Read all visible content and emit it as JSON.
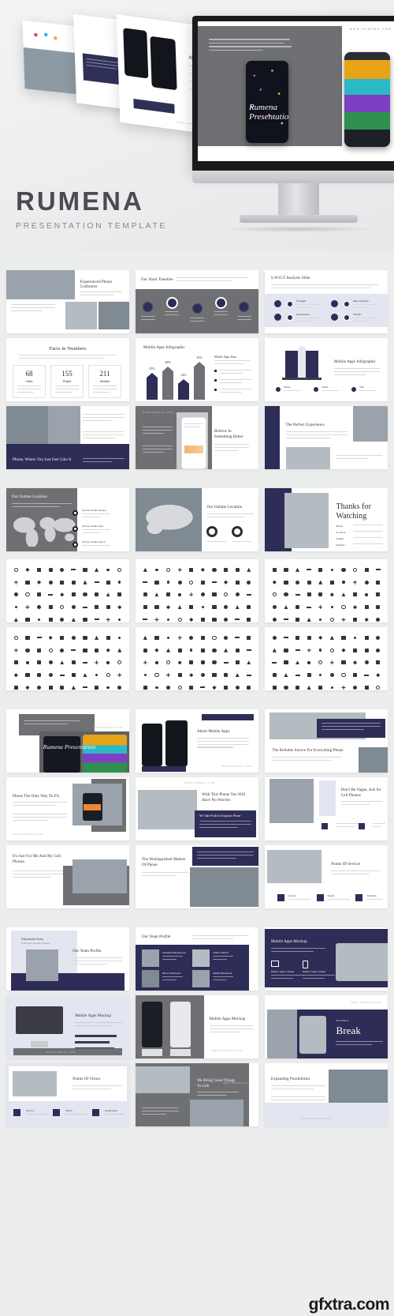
{
  "hero": {
    "brand_name": "RUMENA",
    "brand_subtitle": "PRESENTATION TEMPLATE",
    "mockup_watermark": "WWW.RUMENA.COM",
    "screen_slide_title_line1": "Rumena",
    "screen_slide_title_line2": "Presentation",
    "floating_slide_titles": [
      "With This Phone You Will Have No Worries",
      "About Mobile Apps"
    ],
    "floating_slide_small_label": "We Take Pride In Exquisite Phone"
  },
  "colors": {
    "navy": "#2d2d57",
    "gray": "#6f7073",
    "lavender": "#e3e5f1",
    "page_background": "#eceded",
    "slide_background": "#ffffff",
    "text_dark": "#2e2e35"
  },
  "watermark": "gfxtra.com",
  "sections": [
    {
      "name": "infographic-slides",
      "rows": [
        [
          {
            "title": "Experienced Phone Craftsmen",
            "layout": "image-left-text-right"
          },
          {
            "title": "Our Short Timeline",
            "layout": "timeline-gray",
            "steps": [
              "Brief",
              "Idea",
              "Design",
              "Test",
              "Applicate"
            ]
          },
          {
            "title": "S.W.O.T Analysis Slide",
            "layout": "swot-lavender",
            "items": [
              "Strength",
              "Weaknesses",
              "Opportunities",
              "Threats"
            ]
          }
        ],
        [
          {
            "title": "Facts in Numbers",
            "layout": "stat-boxes",
            "stats": [
              {
                "value": "68",
                "label": "Client"
              },
              {
                "value": "155",
                "label": "Project"
              },
              {
                "value": "211",
                "label": "Website"
              }
            ]
          },
          {
            "title": "Mobile Apps Infographic",
            "layout": "arrow-bars",
            "bars": [
              "25%",
              "28%",
              "14%",
              "35%"
            ]
          },
          {
            "title": "Mobile Apps Infographic",
            "layout": "rocket-illustration",
            "items": [
              "Phone",
              "Tablet",
              "Web"
            ]
          }
        ],
        [
          {
            "title": "Phone, Where You Just Feel Like It",
            "layout": "navy-band-images"
          },
          {
            "title": "Believe In Something Better",
            "layout": "gray-phone-mockup"
          },
          {
            "title": "The Perfect Experience",
            "layout": "navy-sidebar-images"
          }
        ]
      ]
    },
    {
      "name": "map-slides",
      "rows": [
        [
          {
            "title": "Our Outlate Location",
            "layout": "world-map-gray",
            "points": [
              "Service Point Europe",
              "Service Point Asia",
              "Service Point Africa"
            ]
          },
          {
            "title": "Our Outlate Location",
            "layout": "usa-map-photo",
            "charts": [
              "donut",
              "donut"
            ]
          },
          {
            "title": "Thanks for Watching",
            "layout": "navy-sidebar-phone",
            "contacts": [
              "Phone",
              "Location",
              "E-Mail",
              "Website"
            ]
          }
        ]
      ]
    },
    {
      "name": "icon-sheets",
      "rows": [
        [
          {
            "layout": "icon-grid"
          },
          {
            "layout": "icon-grid"
          },
          {
            "layout": "icon-grid"
          }
        ],
        [
          {
            "layout": "icon-grid"
          },
          {
            "layout": "icon-grid"
          },
          {
            "layout": "icon-grid"
          }
        ]
      ]
    },
    {
      "name": "content-slides",
      "rows": [
        [
          {
            "title": "Rumena Presentation",
            "layout": "cover-gray-phone"
          },
          {
            "title": "About Mobile Apps",
            "layout": "two-phones-text"
          },
          {
            "title": "The Reliable Source For Everything Phone",
            "layout": "desk-photo-navy-box"
          }
        ],
        [
          {
            "title": "Phone The Only Way To Fly",
            "layout": "text-left-photo-right"
          },
          {
            "title": "With This Phone You Will Have No Worries",
            "layout": "photo-navy-caption",
            "caption": "We Take Pride In Exquisite Phone"
          },
          {
            "title": "Don't Be Vague, Ask for Cell Phones",
            "layout": "portrait-photo-text"
          }
        ],
        [
          {
            "title": "It's Just For Me And My Cell Phones",
            "layout": "text-photo-split"
          },
          {
            "title": "The Distinguished Makers Of Phone",
            "layout": "navy-box-keyboard"
          },
          {
            "title": "Points Of Service",
            "layout": "three-icon-cards",
            "items": [
              "Service",
              "Repair",
              "Warranty"
            ]
          }
        ]
      ]
    },
    {
      "name": "team-and-mockup-slides",
      "rows": [
        [
          {
            "title": "Our Team Profile",
            "subtitle": "Anastasiia Grey",
            "role": "Lead Team Creative Design",
            "layout": "profile-lavender"
          },
          {
            "title": "Our Team Profile",
            "layout": "team-grid-navy",
            "members": [
              "Anastasia Blackwood",
              "James Ashford",
              "Oliver Eastwood",
              "Ahmed Hasanovic"
            ]
          },
          {
            "title": "Mobile Apps Mockup",
            "layout": "navy-tablet-mockup",
            "items": [
              "Mobile Apps Content",
              "Mobile Apps Content"
            ]
          }
        ],
        [
          {
            "title": "Mobile Apps Mockup",
            "layout": "imac-mockup-lavender"
          },
          {
            "title": "Mobile Apps Mockup",
            "layout": "two-phones-gray"
          },
          {
            "title": "Break",
            "subtitle": "It's Time to",
            "layout": "navy-break-photo",
            "body": "Individual commitment to a group effort that is what makes a team work, a company work, a society"
          }
        ],
        [
          {
            "title": "Points Of Vision",
            "layout": "tablet-photo-icon-cards",
            "items": [
              "Service",
              "Vision",
              "Application"
            ]
          },
          {
            "title": "We Bring Good Things To Life",
            "layout": "gray-desk-photos"
          },
          {
            "title": "Expanding Possibilities",
            "layout": "text-phone-photo"
          }
        ]
      ]
    }
  ]
}
